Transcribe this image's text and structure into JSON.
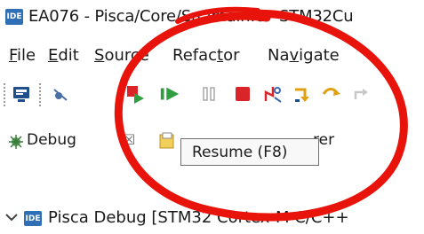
{
  "window": {
    "ide_badge": "IDE",
    "title": "EA076 - Pisca/Core/Src/main.c - STM32Cu"
  },
  "menu": {
    "items": [
      {
        "label": "File",
        "mnemonic": "F"
      },
      {
        "label": "Edit",
        "mnemonic": "E"
      },
      {
        "label": "Source",
        "mnemonic": "S"
      },
      {
        "label": "Refactor",
        "mnemonic": "t"
      },
      {
        "label": "Navigate",
        "mnemonic": "v"
      }
    ]
  },
  "toolbar": {
    "icons": [
      "console-icon",
      "skip-breakpoints-icon",
      "terminate-relaunch-icon",
      "resume-icon",
      "suspend-icon",
      "terminate-icon",
      "disconnect-icon",
      "step-into-icon",
      "step-over-icon",
      "step-return-icon"
    ]
  },
  "tabs": {
    "debug_label": "Debug",
    "close_glyph": "☒",
    "second_tab_label_partial": "rer"
  },
  "tooltip": {
    "text": "Resume (F8)"
  },
  "tree": {
    "badge": "IDE",
    "label": "Pisca Debug [STM32 Cortex-M C/C++"
  },
  "colors": {
    "annotation_red": "#e8140c",
    "ide_blue": "#2f6fb5",
    "resume_green": "#2e9e3e",
    "terminate_red": "#d9252a"
  }
}
